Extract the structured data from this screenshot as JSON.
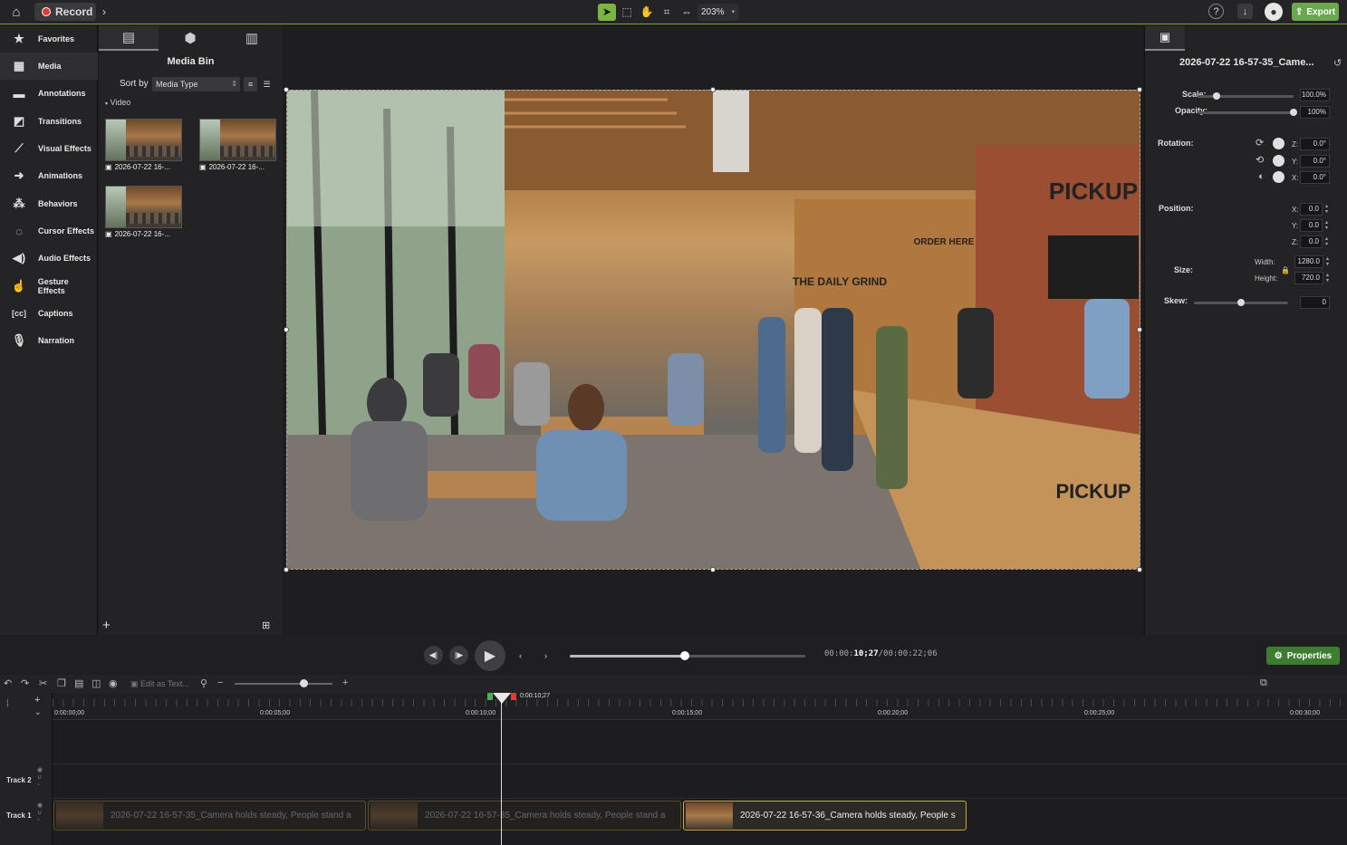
{
  "topbar": {
    "record_label": "Record",
    "zoom": "203%",
    "export_label": "Export"
  },
  "sidebar": {
    "items": [
      {
        "label": "Favorites",
        "icon": "star"
      },
      {
        "label": "Media",
        "icon": "film"
      },
      {
        "label": "Annotations",
        "icon": "annotation"
      },
      {
        "label": "Transitions",
        "icon": "transition"
      },
      {
        "label": "Visual Effects",
        "icon": "wand"
      },
      {
        "label": "Animations",
        "icon": "arrow"
      },
      {
        "label": "Behaviors",
        "icon": "behaviors"
      },
      {
        "label": "Cursor Effects",
        "icon": "cursor"
      },
      {
        "label": "Audio Effects",
        "icon": "speaker"
      },
      {
        "label": "Gesture Effects",
        "icon": "hand"
      },
      {
        "label": "Captions",
        "icon": "cc"
      },
      {
        "label": "Narration",
        "icon": "microphone"
      }
    ]
  },
  "media_bin": {
    "title": "Media Bin",
    "sort_label": "Sort by",
    "sort_value": "Media Type",
    "group_label": "Video",
    "items": [
      {
        "name": "2026-07-22 16-..."
      },
      {
        "name": "2026-07-22 16-..."
      },
      {
        "name": "2026-07-22 16-..."
      }
    ]
  },
  "canvas": {
    "signs": {
      "pickup": "PICKUP",
      "order_here": "ORDER HERE",
      "daily": "THE DAILY GRIND",
      "counter": "PICKUP"
    }
  },
  "properties": {
    "title": "2026-07-22 16-57-35_Came...",
    "scale_label": "Scale:",
    "scale_value": "100.0%",
    "scale_level": 0.2,
    "opacity_label": "Opacity:",
    "opacity_value": "100%",
    "opacity_level": 1.0,
    "rotation_label": "Rotation:",
    "rot_z_label": "Z:",
    "rot_z": "0.0°",
    "rot_y_label": "Y:",
    "rot_y": "0.0°",
    "rot_x_label": "X:",
    "rot_x": "0.0°",
    "position_label": "Position:",
    "pos_x_label": "X:",
    "pos_x": "0.0",
    "pos_y_label": "Y:",
    "pos_y": "0.0",
    "pos_z_label": "Z:",
    "pos_z": "0.0",
    "size_label": "Size:",
    "width_label": "Width:",
    "width": "1280.0",
    "height_label": "Height:",
    "height": "720.0",
    "skew_label": "Skew:",
    "skew": "0",
    "skew_level": 0.5
  },
  "playback": {
    "current": "10;27",
    "current_prefix": "00:00:",
    "total": "/00:00:22;06",
    "progress": 0.49,
    "properties_label": "Properties"
  },
  "timeline": {
    "edit_as_text": "Edit as Text...",
    "playhead_time": "0:00:10;27",
    "ticks": [
      "0:00:00;00",
      "0:00:05;00",
      "0:00:10;00",
      "0:00:15;00",
      "0:00:20;00",
      "0:00:25;00",
      "0:00:30;00"
    ],
    "tracks": [
      "Track 2",
      "Track 1"
    ],
    "clips": [
      {
        "label": "2026-07-22 16-57-35_Camera holds steady, People stand a"
      },
      {
        "label": "2026-07-22 16-57-35_Camera holds steady, People stand a"
      },
      {
        "label": "2026-07-22 16-57-36_Camera holds steady, People s"
      }
    ]
  }
}
